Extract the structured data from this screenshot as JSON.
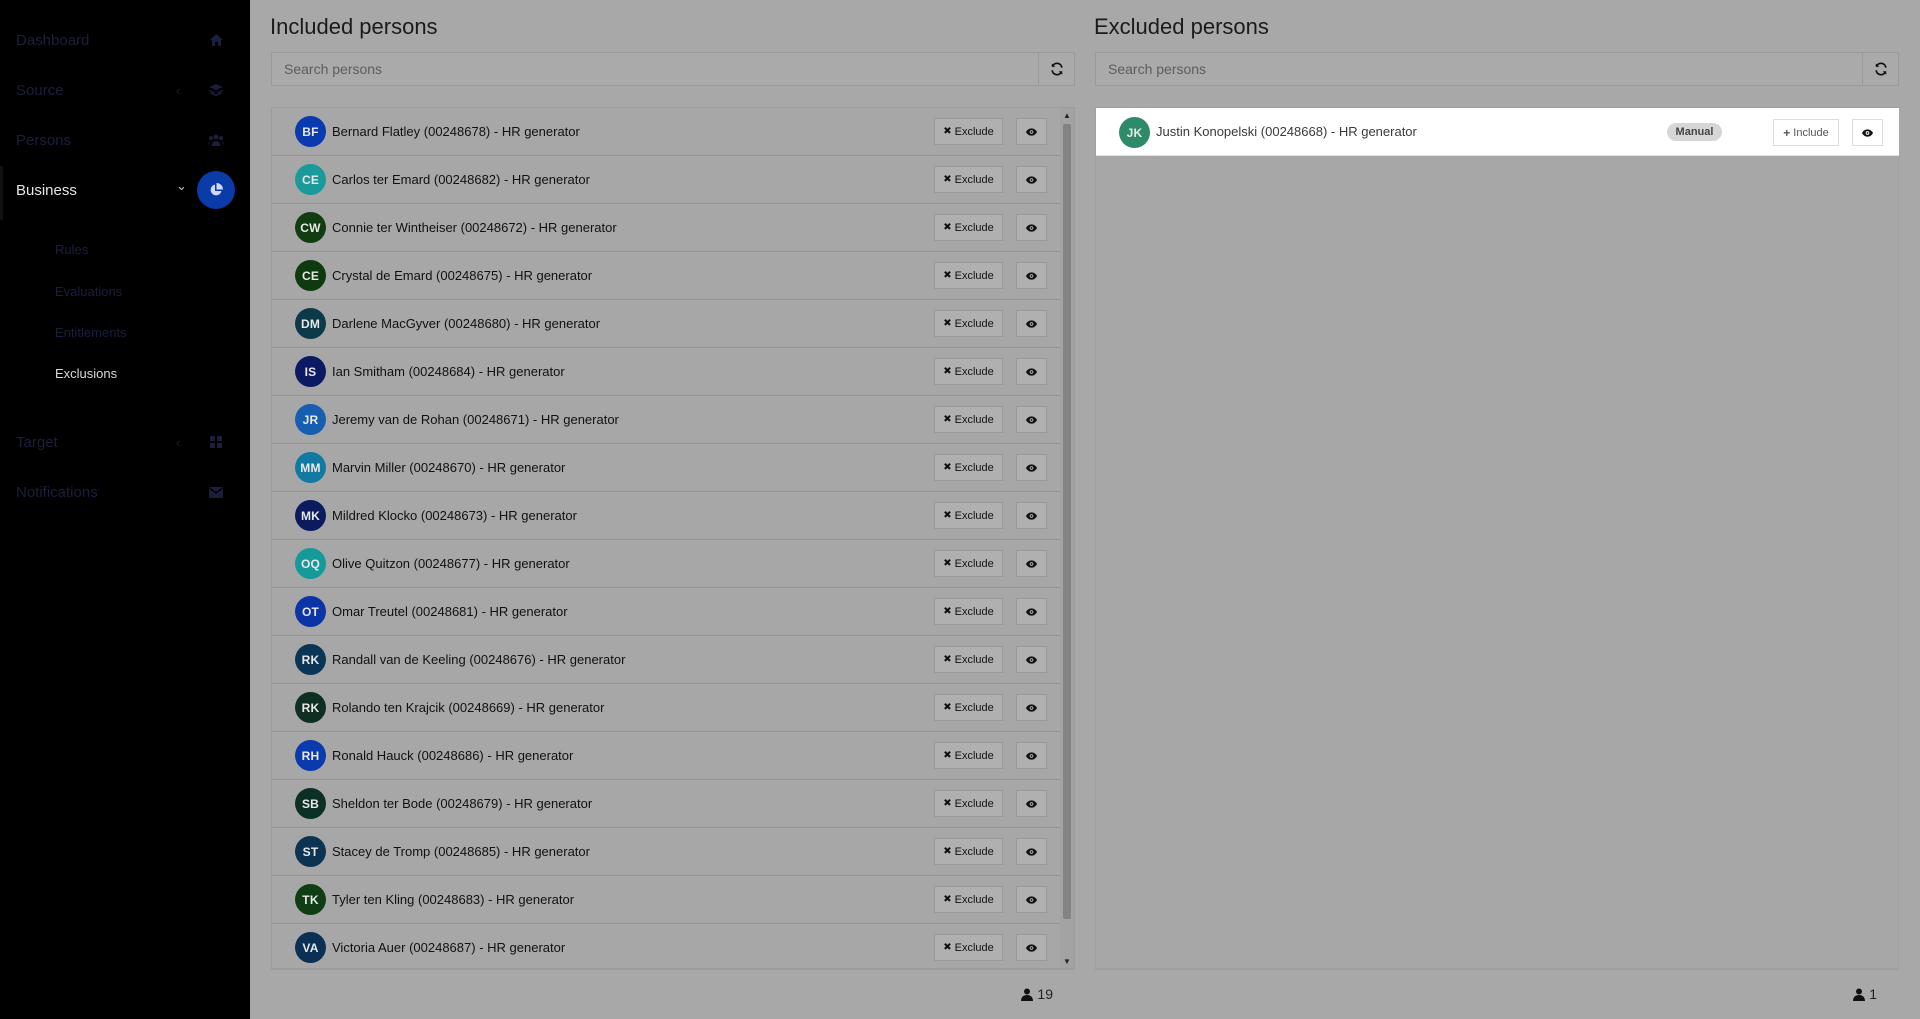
{
  "sidebar": {
    "items": [
      {
        "label": "Dashboard",
        "icon": "home-icon",
        "has_chevron": false
      },
      {
        "label": "Source",
        "icon": "database-icon",
        "has_chevron": true
      },
      {
        "label": "Persons",
        "icon": "users-icon",
        "has_chevron": false
      },
      {
        "label": "Business",
        "icon": "pie-chart-icon",
        "has_chevron": true,
        "active": true
      },
      {
        "label": "Target",
        "icon": "grid-icon",
        "has_chevron": true
      },
      {
        "label": "Notifications",
        "icon": "envelope-icon",
        "has_chevron": false
      }
    ],
    "subitems": [
      {
        "label": "Rules"
      },
      {
        "label": "Evaluations"
      },
      {
        "label": "Entitlements"
      },
      {
        "label": "Exclusions",
        "active": true
      }
    ]
  },
  "included": {
    "title": "Included persons",
    "search_placeholder": "Search persons",
    "exclude_label": "Exclude",
    "count": "19",
    "persons": [
      {
        "initials": "BF",
        "name": "Bernard Flatley (00248678) - HR generator",
        "color": "#0b3ab0"
      },
      {
        "initials": "CE",
        "name": "Carlos ter Emard (00248682) - HR generator",
        "color": "#1a9a9a"
      },
      {
        "initials": "CW",
        "name": "Connie ter Wintheiser (00248672) - HR generator",
        "color": "#123d12"
      },
      {
        "initials": "CE",
        "name": "Crystal de Emard (00248675) - HR generator",
        "color": "#0f3a0f"
      },
      {
        "initials": "DM",
        "name": "Darlene MacGyver (00248680) - HR generator",
        "color": "#0c3a49"
      },
      {
        "initials": "IS",
        "name": "Ian Smitham (00248684) - HR generator",
        "color": "#0c1a63"
      },
      {
        "initials": "JR",
        "name": "Jeremy van de Rohan (00248671) - HR generator",
        "color": "#175db0"
      },
      {
        "initials": "MM",
        "name": "Marvin Miller (00248670) - HR generator",
        "color": "#127aa2"
      },
      {
        "initials": "MK",
        "name": "Mildred Klocko (00248673) - HR generator",
        "color": "#0b1b5e"
      },
      {
        "initials": "OQ",
        "name": "Olive Quitzon (00248677) - HR generator",
        "color": "#159a9a"
      },
      {
        "initials": "OT",
        "name": "Omar Treutel (00248681) - HR generator",
        "color": "#0b34a6"
      },
      {
        "initials": "RK",
        "name": "Randall van de Keeling (00248676) - HR generator",
        "color": "#0b3555"
      },
      {
        "initials": "RK",
        "name": "Rolando ten Krajcik (00248669) - HR generator",
        "color": "#0e2f22"
      },
      {
        "initials": "RH",
        "name": "Ronald Hauck (00248686) - HR generator",
        "color": "#0b3aad"
      },
      {
        "initials": "SB",
        "name": "Sheldon ter Bode (00248679) - HR generator",
        "color": "#0c2f26"
      },
      {
        "initials": "ST",
        "name": "Stacey de Tromp (00248685) - HR generator",
        "color": "#0c3352"
      },
      {
        "initials": "TK",
        "name": "Tyler ten Kling (00248683) - HR generator",
        "color": "#0f3e14"
      },
      {
        "initials": "VA",
        "name": "Victoria Auer (00248687) - HR generator",
        "color": "#0b2f55"
      }
    ]
  },
  "excluded": {
    "title": "Excluded persons",
    "search_placeholder": "Search persons",
    "include_label": "Include",
    "count": "1",
    "persons": [
      {
        "initials": "JK",
        "name": "Justin Konopelski (00248668) - HR generator",
        "badge": "Manual",
        "color": "#2e8b6a"
      }
    ]
  }
}
